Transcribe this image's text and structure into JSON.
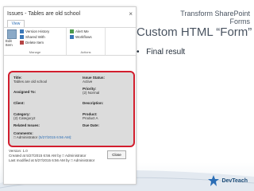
{
  "slide": {
    "title": "Transform SharePoint Forms",
    "heading": "Custom HTML “Form”",
    "bullet": "Final result"
  },
  "window": {
    "title": "Issues - Tables are old school",
    "close": "×",
    "tab": "View"
  },
  "ribbon": {
    "edit_item": "Edit Item",
    "version_history": "Version History",
    "shared_with": "Shared With",
    "delete_item": "Delete Item",
    "alert_me": "Alert Me",
    "workflows": "Workflows",
    "group_manage": "Manage",
    "group_actions": "Actions"
  },
  "form": {
    "title_label": "Title:",
    "title_value": "Tables are old school",
    "issue_status_label": "Issue Status:",
    "issue_status_value": "Active",
    "priority_label": "Priority:",
    "priority_value": "(2) Normal",
    "assigned_to_label": "Assigned To:",
    "client_label": "Client:",
    "description_label": "Description:",
    "category_label": "Category:",
    "category_value": "(2) Category2",
    "product_label": "Product:",
    "product_value": "Product A",
    "related_issues_label": "Related Issues:",
    "due_date_label": "Due Date:",
    "comments_label": "Comments:",
    "comment_author": "Administrator",
    "comment_date": "(5/27/2015 6:56 AM):"
  },
  "footer": {
    "version": "Version: 1.0",
    "created": "Created at 5/27/2015 6:56 AM  by  □ Administrator",
    "modified": "Last modified at 5/27/2015 6:56 AM  by  □ Administrator",
    "close_button": "Close"
  },
  "logo": {
    "text": "DevTeach"
  }
}
